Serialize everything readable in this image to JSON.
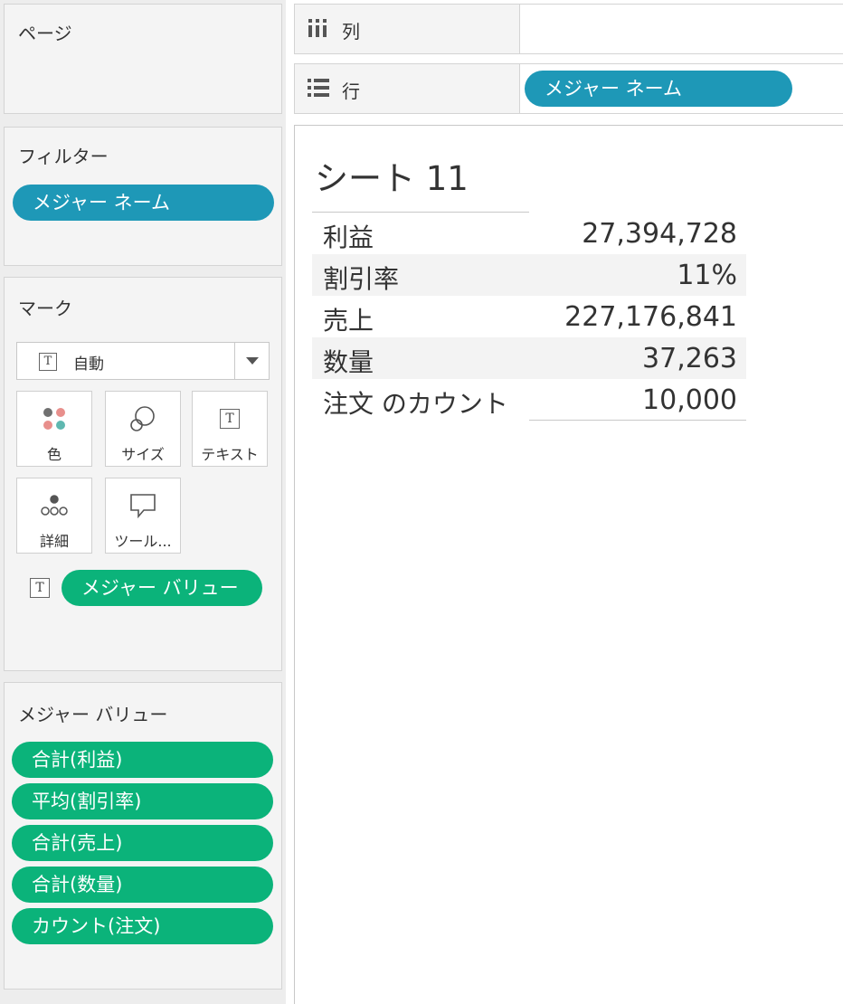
{
  "pages_shelf": {
    "title": "ページ"
  },
  "filters_shelf": {
    "title": "フィルター",
    "pill": "メジャー ネーム"
  },
  "marks_card": {
    "title": "マーク",
    "mark_type": "自動",
    "tiles": {
      "color": "色",
      "size": "サイズ",
      "text": "テキスト",
      "detail": "詳細",
      "tooltip": "ツール..."
    },
    "text_pill": "メジャー バリュー"
  },
  "measure_values_card": {
    "title": "メジャー バリュー",
    "pills": [
      "合計(利益)",
      "平均(割引率)",
      "合計(売上)",
      "合計(数量)",
      "カウント(注文)"
    ]
  },
  "columns_shelf": {
    "label": "列"
  },
  "rows_shelf": {
    "label": "行",
    "pill": "メジャー ネーム"
  },
  "view": {
    "title": "シート 11",
    "rows": [
      {
        "name": "利益",
        "value": "27,394,728"
      },
      {
        "name": "割引率",
        "value": "11%"
      },
      {
        "name": "売上",
        "value": "227,176,841"
      },
      {
        "name": "数量",
        "value": "37,263"
      },
      {
        "name": "注文 のカウント",
        "value": "10,000"
      }
    ]
  },
  "colors": {
    "blue_pill": "#1e98b7",
    "green_pill": "#0bb37a"
  }
}
